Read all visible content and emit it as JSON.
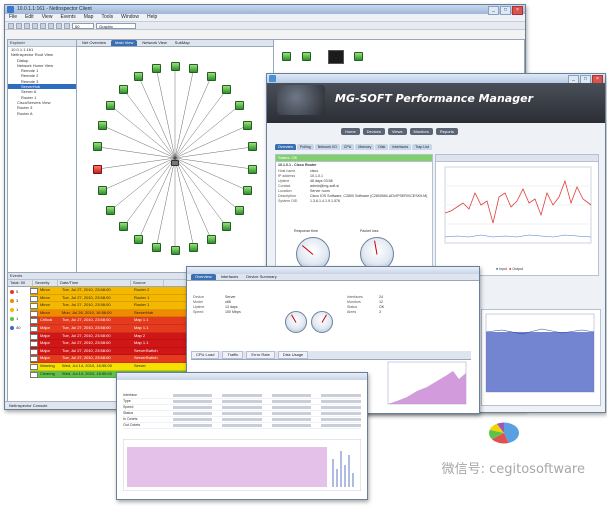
{
  "netinspector": {
    "title": "10.0.1.1:161 - NetInspector Client",
    "menu": [
      "File",
      "Edit",
      "View",
      "Events",
      "Map",
      "Tools",
      "Window",
      "Help"
    ],
    "toolbar_combo": "Graphic",
    "tree_header": "Explorer",
    "tree": [
      "10.0.1.1:161",
      "NetInspector Root View",
      "Dialup",
      "Network Home View",
      "Remote 1",
      "Remote 2",
      "Remote 3",
      "ServerHub",
      "Server A",
      "Router 1",
      "CiscoServers View",
      "Router 3",
      "Router A"
    ],
    "map_tabs": [
      "Net Overview",
      "Main View",
      "Network View",
      "SubMap"
    ],
    "events_header": "Events",
    "events_columns": [
      "Total: 50",
      "Severity",
      "Date/Time",
      "Source"
    ],
    "severity_counts": [
      "5",
      "3",
      "1",
      "1",
      "40"
    ],
    "events": [
      {
        "severity": "Minor",
        "datetime": "Tue, Jul 27, 2010, 23:58:00",
        "source": "Router 2",
        "color": "#f5b800"
      },
      {
        "severity": "Minor",
        "datetime": "Tue, Jul 27, 2010, 23:58:00",
        "source": "Router 1",
        "color": "#f5b800"
      },
      {
        "severity": "Minor",
        "datetime": "Tue, Jul 27, 2010, 23:58:00",
        "source": "Router 1",
        "color": "#f5b800"
      },
      {
        "severity": "Minor",
        "datetime": "Mon, Jul 26, 2010, 16:56:00",
        "source": "ServerHub",
        "color": "#f08a00"
      },
      {
        "severity": "Critical",
        "datetime": "Tue, Jul 27, 2010, 23:58:00",
        "source": "Map 1.1",
        "color": "#e53a1e"
      },
      {
        "severity": "Major",
        "datetime": "Tue, Jul 27, 2010, 23:58:00",
        "source": "Map 1.1",
        "color": "#e53a1e"
      },
      {
        "severity": "Major",
        "datetime": "Tue, Jul 27, 2010, 23:58:00",
        "source": "Map 2",
        "color": "#d01616"
      },
      {
        "severity": "Major",
        "datetime": "Tue, Jul 27, 2010, 23:58:00",
        "source": "Map 1.1",
        "color": "#d01616"
      },
      {
        "severity": "Major",
        "datetime": "Tue, Jul 27, 2010, 23:58:00",
        "source": "ServerSwitch",
        "color": "#d01616"
      },
      {
        "severity": "Major",
        "datetime": "Tue, Jul 27, 2010, 23:58:00",
        "source": "ServerSwitch",
        "color": "#e53a1e"
      },
      {
        "severity": "Warning",
        "datetime": "Wed, Jul 14, 2010, 16:55:00",
        "source": "Server",
        "color": "#f5e000"
      },
      {
        "severity": "Clearing",
        "datetime": "Wed, Jul 14, 2010, 16:55:00",
        "source": "Server",
        "color": "#5ec24a"
      }
    ],
    "statusbar": "NetInspector Console"
  },
  "perfmgr": {
    "title": "MG-SOFT Performance Manager",
    "nav_buttons": [
      "Home",
      "Devices",
      "Views",
      "Monitors",
      "Reports"
    ],
    "device_tabs": [
      "Overview",
      "Polling",
      "Network I/O",
      "CPU",
      "Memory",
      "Disk",
      "Interfaces",
      "Trap List"
    ],
    "panel_status": "Status: OK",
    "panel_title": "10.1.0.1 - Cisco Router",
    "details": [
      {
        "k": "Host name",
        "v": "cisco"
      },
      {
        "k": "IP address",
        "v": "10.1.0.1"
      },
      {
        "k": "Uptime",
        "v": "48 days 03:58"
      },
      {
        "k": "Contact",
        "v": "admin@mg-soft.si"
      },
      {
        "k": "Location",
        "v": "Server room"
      },
      {
        "k": "Description",
        "v": "Cisco IOS Software, C2800 Software (C2800NM-ADVIPSERVICESK9-M)"
      },
      {
        "k": "System OID",
        "v": "1.3.6.1.4.1.9.1.576"
      }
    ],
    "gauge_labels": [
      "Response time",
      "Packet loss"
    ],
    "legend": [
      "Input",
      "Output"
    ]
  },
  "pm_window2": {
    "tabs": [
      "Overview",
      "Interfaces",
      "Device Summary"
    ],
    "info_left": [
      {
        "k": "Device",
        "v": "Server"
      },
      {
        "k": "Model",
        "v": "x86"
      },
      {
        "k": "Uptime",
        "v": "13 days"
      },
      {
        "k": "Speed",
        "v": "100 Mbps"
      }
    ],
    "info_right": [
      {
        "k": "Interfaces",
        "v": "24"
      },
      {
        "k": "Monitors",
        "v": "12"
      },
      {
        "k": "Status",
        "v": "OK"
      },
      {
        "k": "Alerts",
        "v": "3"
      }
    ],
    "bottom_tabs": [
      "CPU Load",
      "Traffic",
      "Error Rate",
      "Disk Usage"
    ]
  },
  "pm_window3": {
    "rows": [
      "Interface",
      "Type",
      "Speed",
      "Status",
      "In Octets",
      "Out Octets"
    ]
  },
  "pie_colors": [
    "#5aa0e0",
    "#e05050",
    "#5ec24a",
    "#f2d400",
    "#9b59b6"
  ],
  "watermark": "微信号: cegitosoftware"
}
